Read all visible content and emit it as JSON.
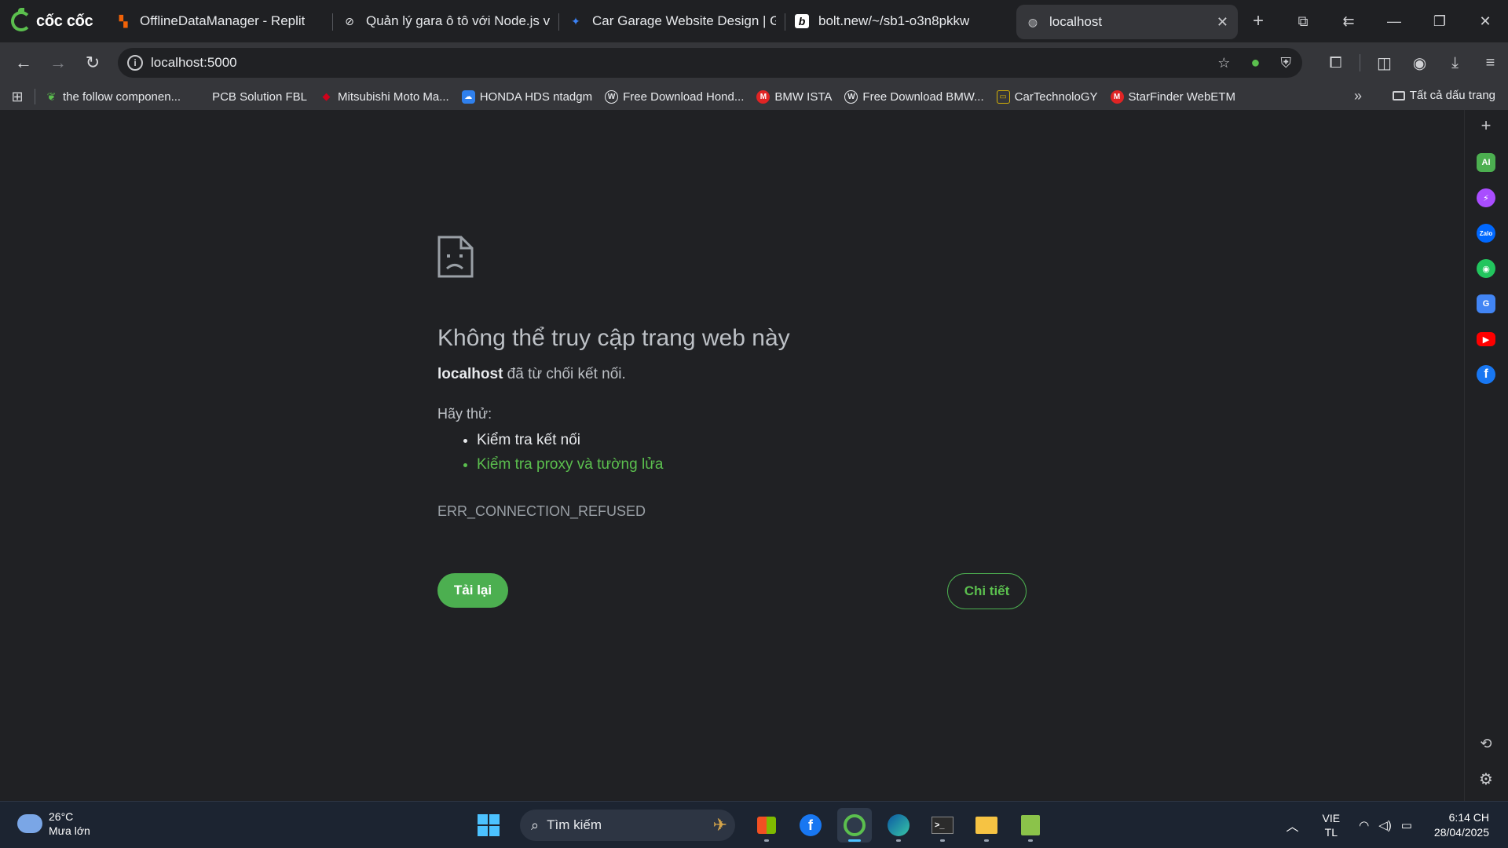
{
  "browser": {
    "brand": "cốc cốc",
    "tabs": [
      {
        "title": "OfflineDataManager - Replit",
        "icon": "replit-icon",
        "color": "#f26207"
      },
      {
        "title": "Quản lý gara ô tô với Node.js và",
        "icon": "chatgpt-icon",
        "color": "#e8eaed"
      },
      {
        "title": "Car Garage Website Design | Go",
        "icon": "butterfly-icon",
        "color": "#3b82f6"
      },
      {
        "title": "bolt.new/~/sb1-o3n8pkkw",
        "icon": "bolt-icon",
        "color": "#ffffff"
      },
      {
        "title": "localhost",
        "icon": "globe-icon",
        "color": "#c8c9cc"
      }
    ],
    "url": "localhost:5000"
  },
  "bookmarks": [
    {
      "label": "the follow componen...",
      "icon": "leaf-icon",
      "color": "#5bbf4e"
    },
    {
      "label": "PCB Solution FBL",
      "icon": "none",
      "color": ""
    },
    {
      "label": "Mitsubishi Moto Ma...",
      "icon": "mitsubishi-icon",
      "color": "#d0021b"
    },
    {
      "label": "HONDA HDS ntadgm",
      "icon": "cloud-icon",
      "color": "#2f80ed"
    },
    {
      "label": "Free Download Hond...",
      "icon": "wordpress-icon",
      "color": "#e8eaed"
    },
    {
      "label": "BMW ISTA",
      "icon": "m-icon",
      "color": "#e02424"
    },
    {
      "label": "Free Download BMW...",
      "icon": "wordpress-icon",
      "color": "#e8eaed"
    },
    {
      "label": "CarTechnoloGY",
      "icon": "car-icon",
      "color": "#d4b106"
    },
    {
      "label": "StarFinder WebETM",
      "icon": "m-icon",
      "color": "#e02424"
    }
  ],
  "bookmarks_all": "Tất cả dấu trang",
  "error": {
    "title": "Không thể truy cập trang web này",
    "host": "localhost",
    "message": " đã từ chối kết nối.",
    "try_label": "Hãy thử:",
    "suggestions": [
      "Kiểm tra kết nối",
      "Kiểm tra proxy và tường lửa"
    ],
    "code": "ERR_CONNECTION_REFUSED",
    "reload_label": "Tải lại",
    "details_label": "Chi tiết"
  },
  "sidebar_icons": [
    {
      "name": "ai-icon",
      "label": "AI",
      "color": "#4caf50"
    },
    {
      "name": "messenger-icon",
      "label": "",
      "color": "#a94dff"
    },
    {
      "name": "zalo-icon",
      "label": "Zalo",
      "color": "#0068ff"
    },
    {
      "name": "game-icon",
      "label": "",
      "color": "#22c55e"
    },
    {
      "name": "translate-icon",
      "label": "G",
      "color": "#4285f4"
    },
    {
      "name": "youtube-icon",
      "label": "▶",
      "color": "#ff0000"
    },
    {
      "name": "facebook-icon",
      "label": "f",
      "color": "#1877f2"
    }
  ],
  "taskbar": {
    "weather_temp": "26°C",
    "weather_desc": "Mưa lớn",
    "search_placeholder": "Tìm kiếm",
    "lang_top": "VIE",
    "lang_bottom": "TL",
    "time": "6:14 CH",
    "date": "28/04/2025"
  }
}
